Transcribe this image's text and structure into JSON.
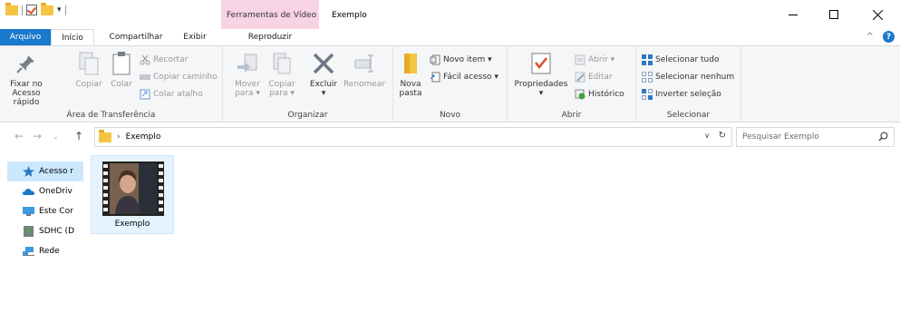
{
  "titlebar": {
    "context_tab_label": "Ferramentas de Vídeo",
    "window_title": "Exemplo",
    "qat_dropdown": "▾"
  },
  "tabs": {
    "file": "Arquivo",
    "home": "Início",
    "share": "Compartilhar",
    "view": "Exibir",
    "play": "Reproduzir"
  },
  "ribbon": {
    "clipboard": {
      "label": "Área de Transferência",
      "pin": "Fixar no\nAcesso rápido",
      "pin_line1": "Fixar no",
      "pin_line2": "Acesso rápido",
      "copy": "Copiar",
      "paste": "Colar",
      "cut": "Recortar",
      "copy_path": "Copiar caminho",
      "paste_shortcut": "Colar atalho"
    },
    "organize": {
      "label": "Organizar",
      "move_line1": "Mover",
      "move_line2": "para ▾",
      "copy_line1": "Copiar",
      "copy_line2": "para ▾",
      "delete": "Excluir",
      "delete_drop": "▾",
      "rename": "Renomear"
    },
    "new": {
      "label": "Novo",
      "new_folder_line1": "Nova",
      "new_folder_line2": "pasta",
      "new_item": "Novo item ▾",
      "easy_access": "Fácil acesso ▾"
    },
    "open": {
      "label": "Abrir",
      "properties": "Propriedades",
      "properties_drop": "▾",
      "open": "Abrir ▾",
      "edit": "Editar",
      "history": "Histórico"
    },
    "select": {
      "label": "Selecionar",
      "select_all": "Selecionar tudo",
      "select_none": "Selecionar nenhum",
      "invert": "Inverter seleção"
    }
  },
  "address": {
    "path": "Exemplo",
    "separator": "›",
    "search_placeholder": "Pesquisar Exemplo"
  },
  "navpane": {
    "items": [
      {
        "label": "Acesso r",
        "icon": "star-icon"
      },
      {
        "label": "OneDriv",
        "icon": "cloud-icon"
      },
      {
        "label": "Este Cor",
        "icon": "computer-icon"
      },
      {
        "label": "SDHC (D",
        "icon": "sd-card-icon"
      },
      {
        "label": "Rede",
        "icon": "network-icon"
      }
    ]
  },
  "files": [
    {
      "name": "Exemplo",
      "type": "video"
    }
  ],
  "colors": {
    "accent": "#1979ca",
    "context_tab": "#f7d3e3",
    "selection": "#cce8ff",
    "folder": "#f4c542"
  }
}
